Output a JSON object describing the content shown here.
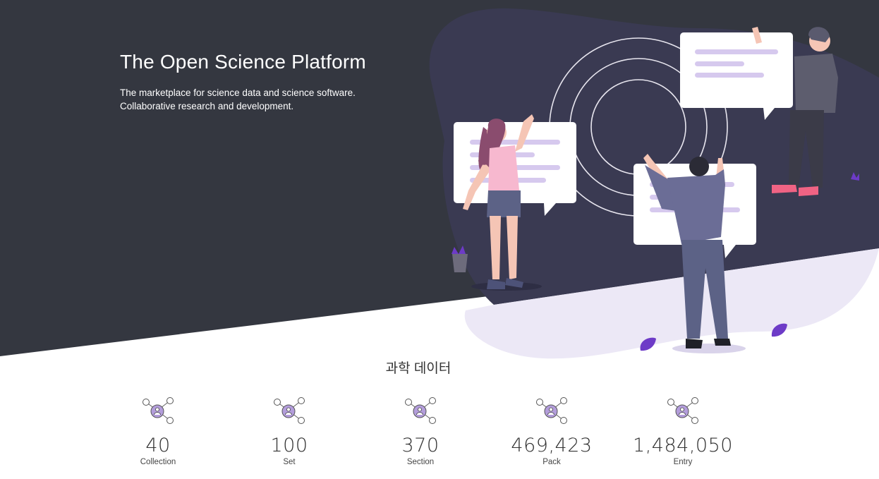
{
  "hero": {
    "title": "The Open Science Platform",
    "subtitle_line1": "The marketplace for science data and science software.",
    "subtitle_line2": "Collaborative research and development.",
    "background_color": "#343740",
    "illustration": "team-collaboration-illustration"
  },
  "stats_section": {
    "title": "과학 데이터",
    "icon": "network-people-icon",
    "accent_color": "#b39ddb",
    "items": [
      {
        "value": "40",
        "label": "Collection"
      },
      {
        "value": "100",
        "label": "Set"
      },
      {
        "value": "370",
        "label": "Section"
      },
      {
        "value": "469,423",
        "label": "Pack"
      },
      {
        "value": "1,484,050",
        "label": "Entry"
      }
    ]
  }
}
